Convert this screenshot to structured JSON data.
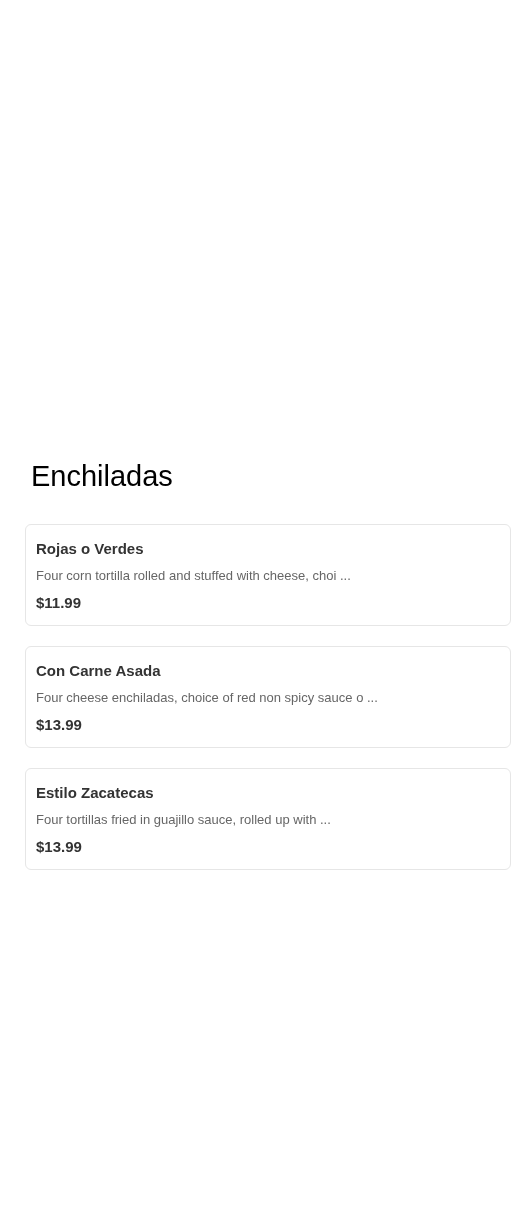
{
  "section": {
    "title": "Enchiladas",
    "items": [
      {
        "name": "Rojas o Verdes",
        "description": "Four corn tortilla rolled and stuffed with cheese, choi ...",
        "price": "$11.99"
      },
      {
        "name": "Con Carne Asada",
        "description": "Four cheese enchiladas, choice of red non spicy sauce o ...",
        "price": "$13.99"
      },
      {
        "name": "Estilo Zacatecas",
        "description": "Four tortillas fried in guajillo sauce, rolled up with ...",
        "price": "$13.99"
      }
    ]
  }
}
